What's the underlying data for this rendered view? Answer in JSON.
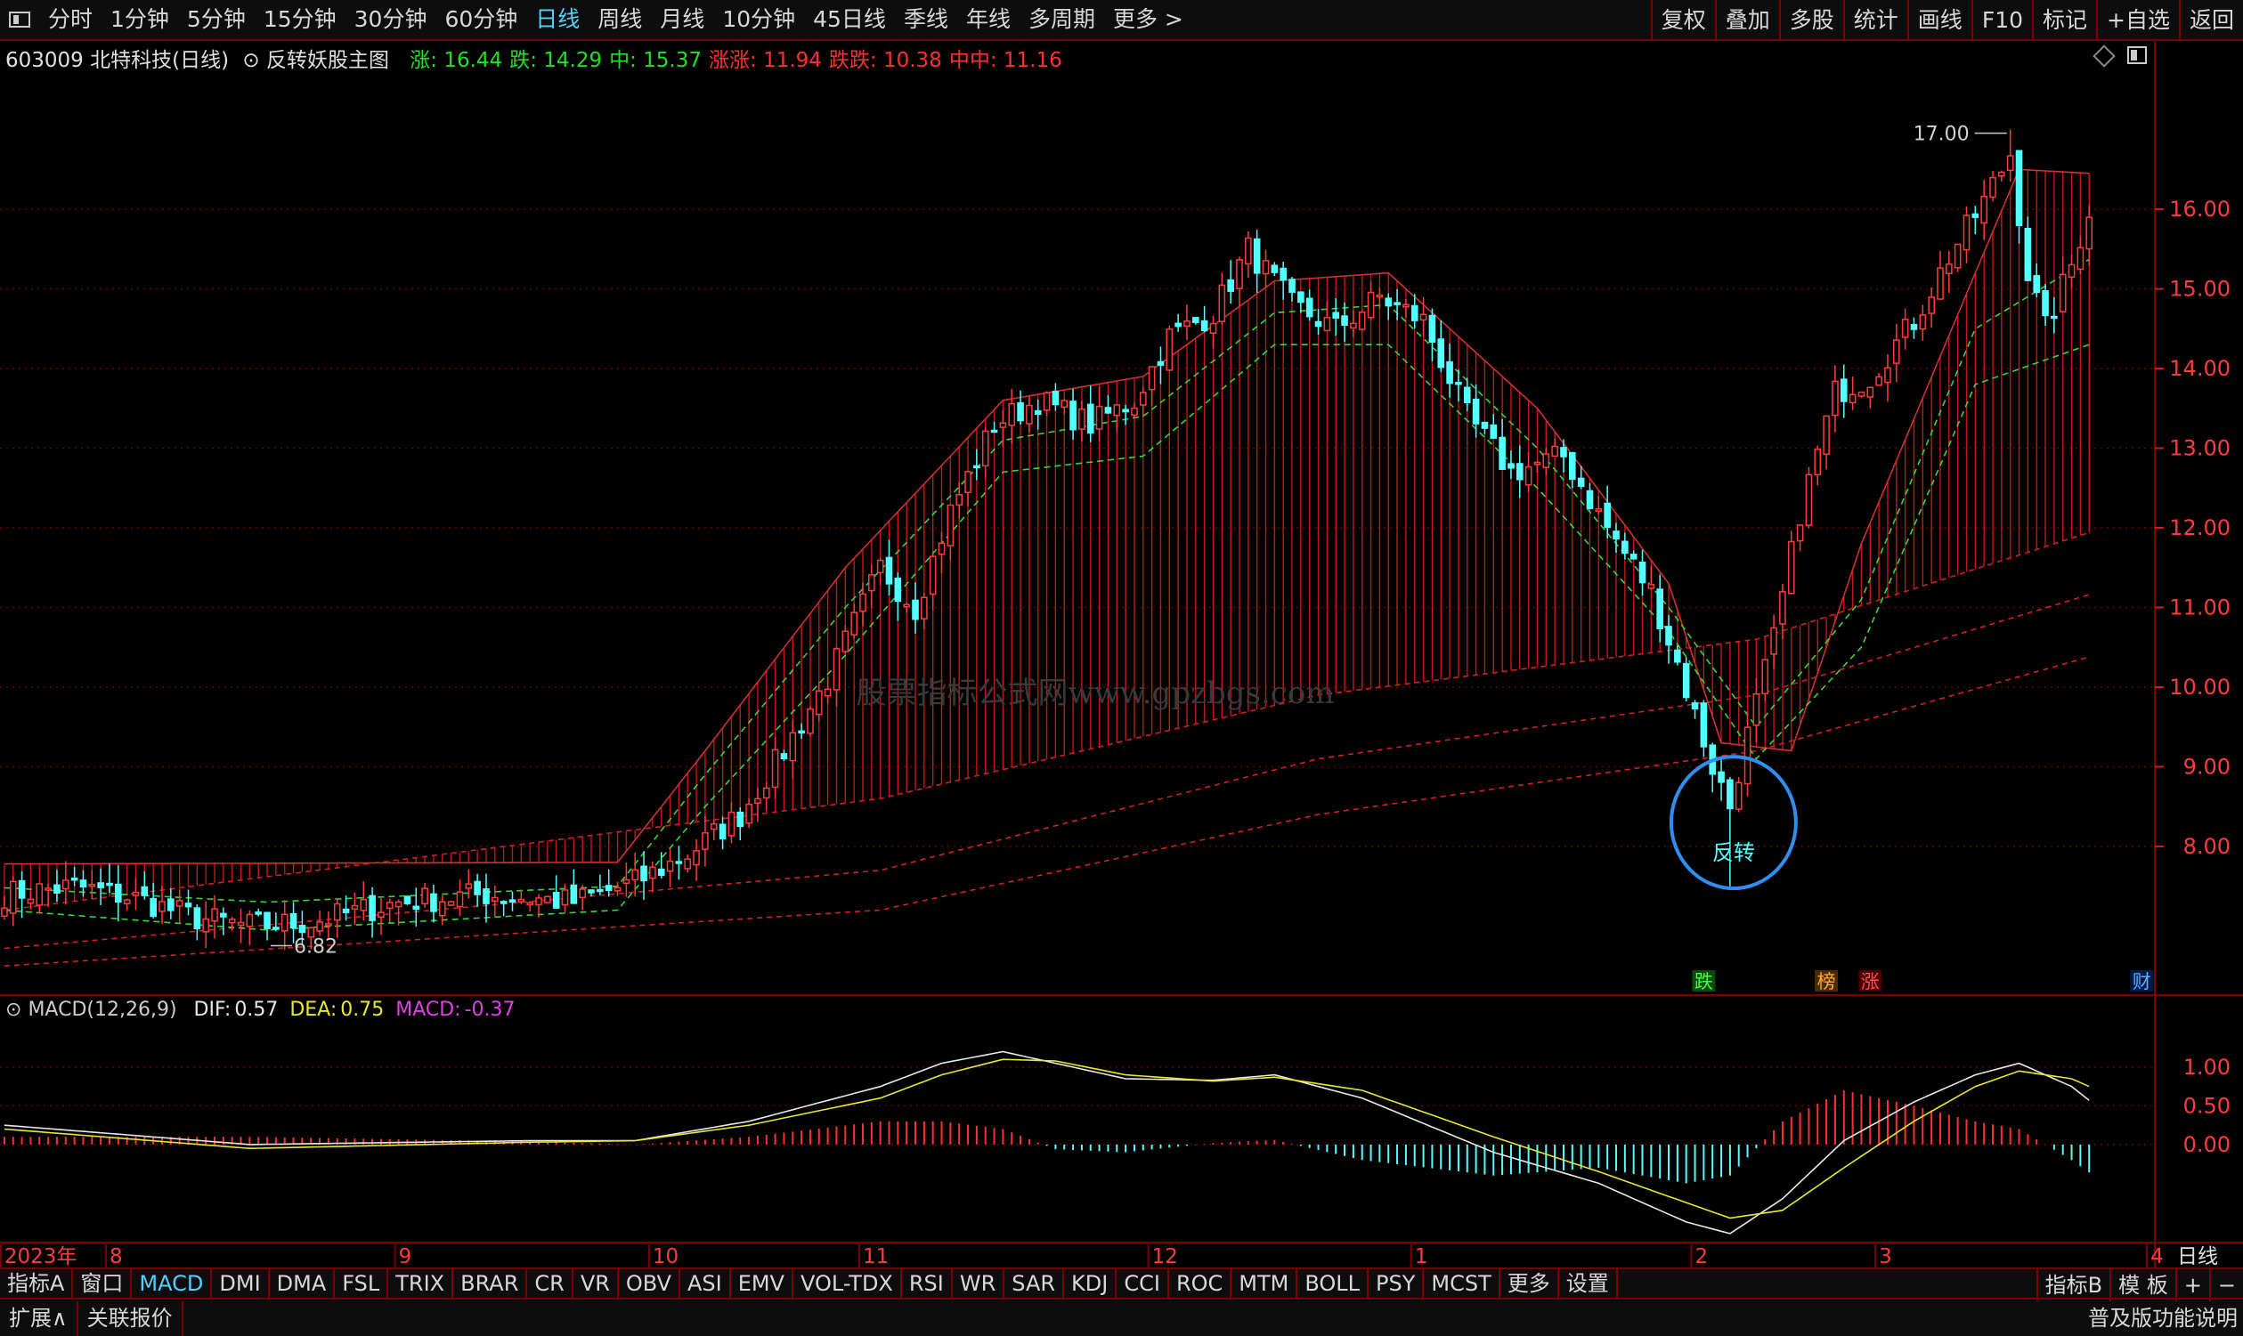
{
  "toolbar": {
    "periods": [
      "分时",
      "1分钟",
      "5分钟",
      "15分钟",
      "30分钟",
      "60分钟",
      "日线",
      "周线",
      "月线",
      "10分钟",
      "45日线",
      "季线",
      "年线",
      "多周期",
      "更多 >"
    ],
    "active_period": "日线",
    "right_buttons": [
      "复权",
      "叠加",
      "多股",
      "统计",
      "画线",
      "F10",
      "标记",
      "+自选",
      "返回"
    ]
  },
  "info": {
    "stock": "603009 北特科技(日线)",
    "indicator": "反转妖股主图",
    "items": [
      {
        "label": "涨:",
        "value": "16.44",
        "color": "#22e022"
      },
      {
        "label": "跌:",
        "value": "14.29",
        "color": "#22e022"
      },
      {
        "label": "中:",
        "value": "15.37",
        "color": "#22e022"
      },
      {
        "label": "涨涨:",
        "value": "11.94",
        "color": "#ff3030"
      },
      {
        "label": "跌跌:",
        "value": "10.38",
        "color": "#ff3030"
      },
      {
        "label": "中中:",
        "value": "11.16",
        "color": "#ff3030"
      }
    ]
  },
  "macd_info": {
    "name": "MACD(12,26,9)",
    "dif_label": "DIF:",
    "dif": "0.57",
    "dea_label": "DEA:",
    "dea": "0.75",
    "macd_label": "MACD:",
    "macd": "-0.37"
  },
  "watermark": "股票指标公式网www.gpzbgs.com",
  "annotations": {
    "high": "17.00",
    "low": "6.82",
    "reversal": "反转",
    "markers": [
      {
        "text": "跌",
        "bg": "#0a4a0a",
        "color": "#44ff44",
        "index": 194
      },
      {
        "text": "榜",
        "bg": "#4a2a00",
        "color": "#ffaa33",
        "index": 208
      },
      {
        "text": "涨",
        "bg": "#4a0000",
        "color": "#ff5050",
        "index": 213
      },
      {
        "text": "财",
        "bg": "#001a4a",
        "color": "#66aaff",
        "index": 244
      }
    ]
  },
  "x_axis": {
    "labels": [
      {
        "text": "2023年",
        "index": 0
      },
      {
        "text": "8",
        "index": 12
      },
      {
        "text": "9",
        "index": 45
      },
      {
        "text": "10",
        "index": 74
      },
      {
        "text": "11",
        "index": 98
      },
      {
        "text": "12",
        "index": 131
      },
      {
        "text": "1",
        "index": 161
      },
      {
        "text": "2",
        "index": 193
      },
      {
        "text": "3",
        "index": 214
      },
      {
        "text": "4",
        "index": 245
      }
    ],
    "corner": "日线"
  },
  "bottom": {
    "indicators": [
      "指标A",
      "窗口",
      "MACD",
      "DMI",
      "DMA",
      "FSL",
      "TRIX",
      "BRAR",
      "CR",
      "VR",
      "OBV",
      "ASI",
      "EMV",
      "VOL-TDX",
      "RSI",
      "WR",
      "SAR",
      "KDJ",
      "CCI",
      "ROC",
      "MTM",
      "BOLL",
      "PSY",
      "MCST",
      "更多",
      "设置"
    ],
    "active": "MACD",
    "right": [
      "指标B",
      "模 板",
      "+",
      "−"
    ],
    "row2": [
      "扩展∧",
      "关联报价"
    ],
    "row2_right": "普及版功能说明"
  },
  "chart_data": [
    {
      "type": "candlestick",
      "title": "",
      "y_ticks": [
        8.0,
        9.0,
        10.0,
        11.0,
        12.0,
        13.0,
        14.0,
        15.0,
        16.0
      ],
      "ylim": [
        6.2,
        17.8
      ],
      "x_count": 246,
      "anchors_close": [
        [
          0,
          7.4
        ],
        [
          8,
          7.5
        ],
        [
          15,
          7.35
        ],
        [
          22,
          7.1
        ],
        [
          28,
          7.0
        ],
        [
          35,
          7.05
        ],
        [
          45,
          7.3
        ],
        [
          55,
          7.4
        ],
        [
          65,
          7.3
        ],
        [
          72,
          7.55
        ],
        [
          78,
          7.9
        ],
        [
          84,
          8.4
        ],
        [
          89,
          9.2
        ],
        [
          94,
          10.1
        ],
        [
          100,
          11.5
        ],
        [
          104,
          11.0
        ],
        [
          108,
          12.2
        ],
        [
          113,
          13.3
        ],
        [
          118,
          13.6
        ],
        [
          124,
          13.3
        ],
        [
          129,
          13.6
        ],
        [
          133,
          14.4
        ],
        [
          138,
          14.7
        ],
        [
          142,
          15.5
        ],
        [
          147,
          14.8
        ],
        [
          152,
          14.5
        ],
        [
          157,
          14.9
        ],
        [
          162,
          14.6
        ],
        [
          167,
          13.4
        ],
        [
          172,
          12.7
        ],
        [
          178,
          12.9
        ],
        [
          183,
          12.0
        ],
        [
          188,
          11.2
        ],
        [
          191,
          10.3
        ],
        [
          195,
          9.0
        ],
        [
          197,
          8.5
        ],
        [
          199,
          9.4
        ],
        [
          202,
          10.6
        ],
        [
          205,
          12.2
        ],
        [
          209,
          13.7
        ],
        [
          213,
          13.9
        ],
        [
          218,
          14.6
        ],
        [
          222,
          15.4
        ],
        [
          226,
          16.1
        ],
        [
          229,
          16.7
        ],
        [
          231,
          15.2
        ],
        [
          233,
          14.5
        ],
        [
          236,
          15.3
        ],
        [
          238,
          16.0
        ]
      ],
      "high": 17.0,
      "low": 6.82,
      "bands": {
        "upper": [
          [
            0,
            7.78
          ],
          [
            70,
            7.8
          ],
          [
            80,
            9.2
          ],
          [
            96,
            11.5
          ],
          [
            114,
            13.6
          ],
          [
            130,
            13.9
          ],
          [
            145,
            15.1
          ],
          [
            158,
            15.2
          ],
          [
            175,
            13.5
          ],
          [
            190,
            11.3
          ],
          [
            196,
            9.3
          ],
          [
            204,
            9.2
          ],
          [
            212,
            11.8
          ],
          [
            225,
            15.2
          ],
          [
            230,
            16.5
          ],
          [
            238,
            16.45
          ]
        ],
        "lower": [
          [
            0,
            7.2
          ],
          [
            30,
            6.95
          ],
          [
            70,
            7.2
          ],
          [
            80,
            8.5
          ],
          [
            96,
            10.4
          ],
          [
            114,
            12.7
          ],
          [
            130,
            12.9
          ],
          [
            145,
            14.3
          ],
          [
            158,
            14.3
          ],
          [
            175,
            12.5
          ],
          [
            190,
            10.7
          ],
          [
            200,
            9.1
          ],
          [
            212,
            10.5
          ],
          [
            225,
            13.8
          ],
          [
            238,
            14.3
          ]
        ],
        "mid": [
          [
            0,
            7.48
          ],
          [
            30,
            7.3
          ],
          [
            70,
            7.5
          ],
          [
            80,
            8.9
          ],
          [
            96,
            11.0
          ],
          [
            114,
            13.1
          ],
          [
            130,
            13.4
          ],
          [
            145,
            14.7
          ],
          [
            158,
            14.8
          ],
          [
            175,
            13.0
          ],
          [
            190,
            11.0
          ],
          [
            200,
            9.5
          ],
          [
            212,
            11.1
          ],
          [
            225,
            14.5
          ],
          [
            238,
            15.37
          ]
        ]
      },
      "long_bands": {
        "upper": [
          [
            0,
            7.2
          ],
          [
            100,
            8.6
          ],
          [
            150,
            9.9
          ],
          [
            200,
            10.6
          ],
          [
            238,
            11.94
          ]
        ],
        "mid": [
          [
            0,
            6.72
          ],
          [
            100,
            7.7
          ],
          [
            150,
            9.1
          ],
          [
            200,
            9.9
          ],
          [
            238,
            11.16
          ]
        ],
        "lower": [
          [
            0,
            6.5
          ],
          [
            100,
            7.2
          ],
          [
            150,
            8.4
          ],
          [
            200,
            9.2
          ],
          [
            238,
            10.38
          ]
        ]
      }
    },
    {
      "type": "macd",
      "title": "MACD(12,26,9)",
      "y_ticks": [
        0.0,
        0.5,
        1.0
      ],
      "ylim": [
        -1.22,
        1.62
      ],
      "dif": [
        [
          0,
          0.25
        ],
        [
          28,
          0.0
        ],
        [
          60,
          0.05
        ],
        [
          72,
          0.05
        ],
        [
          85,
          0.3
        ],
        [
          100,
          0.75
        ],
        [
          107,
          1.05
        ],
        [
          114,
          1.2
        ],
        [
          120,
          1.05
        ],
        [
          128,
          0.85
        ],
        [
          138,
          0.83
        ],
        [
          145,
          0.9
        ],
        [
          155,
          0.6
        ],
        [
          170,
          -0.1
        ],
        [
          182,
          -0.5
        ],
        [
          192,
          -1.0
        ],
        [
          197,
          -1.15
        ],
        [
          203,
          -0.7
        ],
        [
          210,
          0.05
        ],
        [
          218,
          0.55
        ],
        [
          225,
          0.9
        ],
        [
          230,
          1.05
        ],
        [
          236,
          0.75
        ],
        [
          238,
          0.57
        ]
      ],
      "dea": [
        [
          0,
          0.2
        ],
        [
          28,
          -0.05
        ],
        [
          60,
          0.03
        ],
        [
          72,
          0.05
        ],
        [
          85,
          0.25
        ],
        [
          100,
          0.6
        ],
        [
          107,
          0.9
        ],
        [
          114,
          1.1
        ],
        [
          120,
          1.08
        ],
        [
          128,
          0.9
        ],
        [
          138,
          0.82
        ],
        [
          145,
          0.87
        ],
        [
          155,
          0.7
        ],
        [
          170,
          0.1
        ],
        [
          182,
          -0.35
        ],
        [
          192,
          -0.75
        ],
        [
          197,
          -0.95
        ],
        [
          203,
          -0.85
        ],
        [
          210,
          -0.3
        ],
        [
          218,
          0.3
        ],
        [
          225,
          0.75
        ],
        [
          230,
          0.95
        ],
        [
          236,
          0.85
        ],
        [
          238,
          0.75
        ]
      ]
    }
  ]
}
